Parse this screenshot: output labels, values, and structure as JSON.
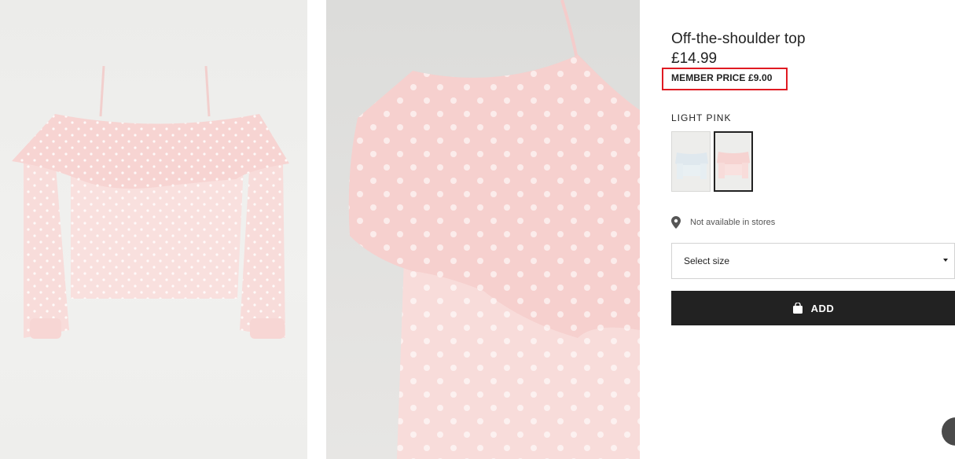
{
  "product": {
    "title": "Off-the-shoulder top",
    "price": "£14.99",
    "member_price": "MEMBER PRICE £9.00"
  },
  "color": {
    "selected_label": "LIGHT PINK",
    "swatches": [
      {
        "name": "light-blue",
        "hex": "#dfe8ee"
      },
      {
        "name": "light-pink",
        "hex": "#f6d8d6",
        "selected": true
      }
    ]
  },
  "availability": {
    "icon": "location-pin-icon",
    "text": "Not available in stores"
  },
  "size_select": {
    "label": "Select size",
    "icon": "caret-down-icon"
  },
  "add_button": {
    "label": "ADD",
    "icon": "shopping-bag-icon"
  },
  "colors": {
    "primary": "#222222",
    "highlight": "#e01a22",
    "product_pink": "#f7d7d5"
  }
}
